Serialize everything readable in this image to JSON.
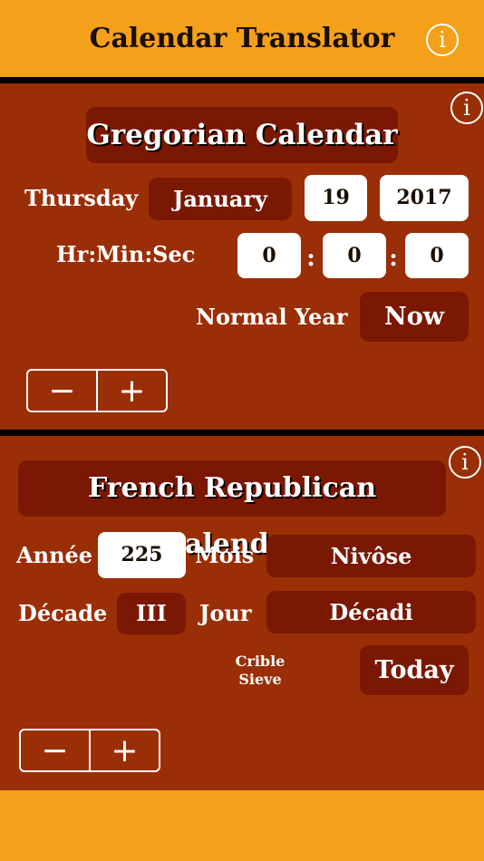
{
  "header": {
    "title": "Calendar Translator",
    "info_icon": "i"
  },
  "gregorian": {
    "info_icon": "i",
    "title": "Gregorian Calendar",
    "weekday": "Thursday",
    "month": "January",
    "day": "19",
    "year": "2017",
    "time_label": "Hr:Min:Sec",
    "hour": "0",
    "minute": "0",
    "second": "0",
    "time_separator": ":",
    "year_type": "Normal Year",
    "now_button": "Now",
    "minus": "−",
    "plus": "+"
  },
  "republican": {
    "info_icon": "i",
    "title": "French Republican Calendar",
    "annee_label": "Année",
    "annee": "225",
    "mois_label": "Mois",
    "mois": "Nivôse",
    "decade_label": "Décade",
    "decade": "III",
    "jour_label": "Jour",
    "jour": "Décadi",
    "day_name_fr": "Crible",
    "day_name_en": "Sieve",
    "today_button": "Today",
    "minus": "−",
    "plus": "+"
  },
  "colors": {
    "accent": "#f4a01a",
    "background": "#9a2e06",
    "pill": "#7a1804"
  }
}
